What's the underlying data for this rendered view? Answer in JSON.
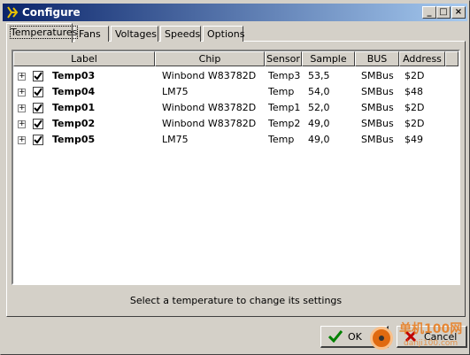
{
  "window": {
    "title": "Configure",
    "min": "_",
    "max": "□",
    "close": "×"
  },
  "tabs": [
    {
      "label": "Temperatures"
    },
    {
      "label": "Fans"
    },
    {
      "label": "Voltages"
    },
    {
      "label": "Speeds"
    },
    {
      "label": "Options"
    }
  ],
  "table": {
    "columns": [
      "Label",
      "Chip",
      "Sensor",
      "Sample",
      "BUS",
      "Address"
    ],
    "rows": [
      {
        "label": "Temp03",
        "chip": "Winbond W83782D",
        "sensor": "Temp3",
        "sample": "53,5",
        "bus": "SMBus",
        "address": "$2D",
        "checked": true
      },
      {
        "label": "Temp04",
        "chip": "LM75",
        "sensor": "Temp",
        "sample": "54,0",
        "bus": "SMBus",
        "address": "$48",
        "checked": true
      },
      {
        "label": "Temp01",
        "chip": "Winbond W83782D",
        "sensor": "Temp1",
        "sample": "52,0",
        "bus": "SMBus",
        "address": "$2D",
        "checked": true
      },
      {
        "label": "Temp02",
        "chip": "Winbond W83782D",
        "sensor": "Temp2",
        "sample": "49,0",
        "bus": "SMBus",
        "address": "$2D",
        "checked": true
      },
      {
        "label": "Temp05",
        "chip": "LM75",
        "sensor": "Temp",
        "sample": "49,0",
        "bus": "SMBus",
        "address": "$49",
        "checked": true
      }
    ]
  },
  "status_text": "Select a temperature to change its settings",
  "buttons": {
    "ok": "OK",
    "cancel": "Cancel"
  },
  "watermark": {
    "line1": "单机100网",
    "line2": "danji100.com"
  }
}
